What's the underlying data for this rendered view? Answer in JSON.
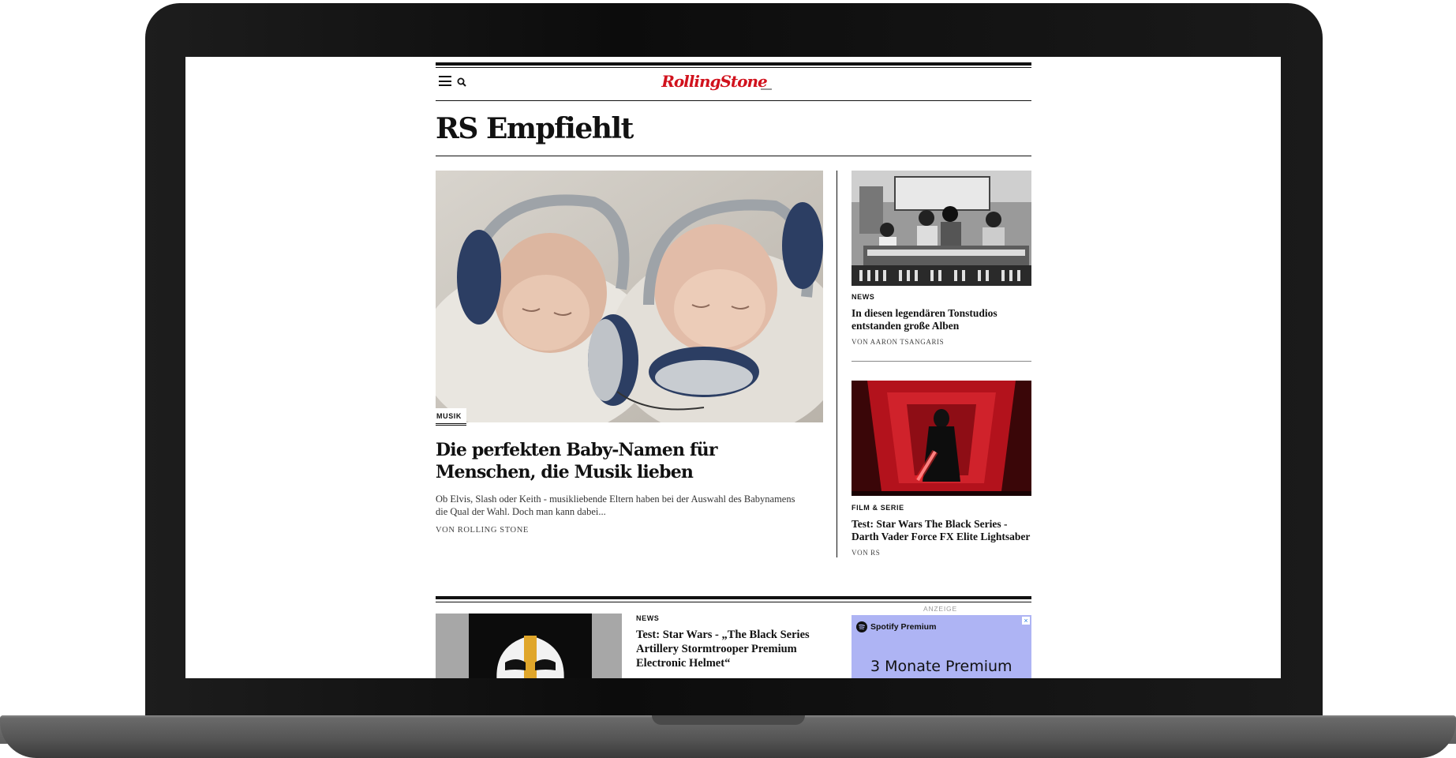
{
  "site": {
    "logo_text": "RollingStone",
    "brand_color": "#d1121d"
  },
  "header": {
    "menu_icon": "hamburger-menu-icon",
    "search_icon": "search-icon"
  },
  "page_title": "RS Empfiehlt",
  "hero": {
    "category": "MUSIK",
    "title": "Die perfekten Baby-Namen für Menschen, die Musik lieben",
    "excerpt": "Ob Elvis, Slash oder Keith - musikliebende Eltern haben bei der Auswahl des Babynamens die Qual der Wahl. Doch man kann dabei...",
    "byline": "VON ROLLING STONE"
  },
  "side_articles": [
    {
      "category": "NEWS",
      "title": "In diesen legendären Tonstudios entstanden große Alben",
      "byline": "VON AARON TSANGARIS"
    },
    {
      "category": "FILM & SERIE",
      "title": "Test: Star Wars The Black Series - Darth Vader Force FX Elite Lightsaber",
      "byline": "VON RS"
    }
  ],
  "bottom_article": {
    "category": "NEWS",
    "title": "Test: Star Wars - „The Black Series Artillery Stormtrooper Premium Electronic Helmet“"
  },
  "ad": {
    "label": "ANZEIGE",
    "brand": "Spotify Premium",
    "headline": "3 Monate Premium",
    "close": "×",
    "background": "#aeb4f4"
  }
}
